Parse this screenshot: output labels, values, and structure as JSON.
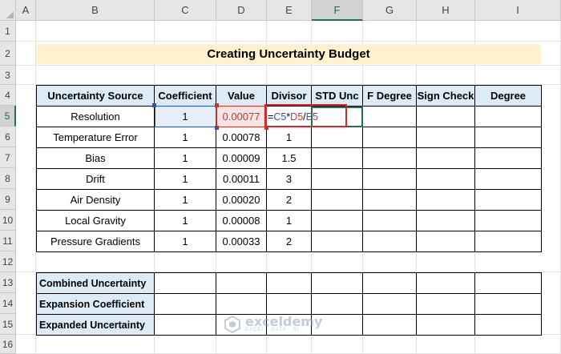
{
  "columns": [
    "A",
    "B",
    "C",
    "D",
    "E",
    "F",
    "G",
    "H",
    "I"
  ],
  "rows": [
    "1",
    "2",
    "3",
    "4",
    "5",
    "6",
    "7",
    "8",
    "9",
    "10",
    "11",
    "12",
    "13",
    "14",
    "15",
    "16"
  ],
  "title": "Creating Uncertainty Budget",
  "table": {
    "headers": [
      "Uncertainty Source",
      "Coefficient",
      "Value",
      "Divisor",
      "STD Unc",
      "F Degree",
      "Sign Check",
      "Degree"
    ],
    "rows": [
      {
        "source": "Resolution",
        "coefficient": "1",
        "value": "0.00077",
        "divisor": ""
      },
      {
        "source": "Temperature Error",
        "coefficient": "1",
        "value": "0.00078",
        "divisor": "1"
      },
      {
        "source": "Bias",
        "coefficient": "1",
        "value": "0.00009",
        "divisor": "1.5"
      },
      {
        "source": "Drift",
        "coefficient": "1",
        "value": "0.00011",
        "divisor": "3"
      },
      {
        "source": "Air Density",
        "coefficient": "1",
        "value": "0.00020",
        "divisor": "2"
      },
      {
        "source": "Local Gravity",
        "coefficient": "1",
        "value": "0.00008",
        "divisor": "1"
      },
      {
        "source": "Pressure Gradients",
        "coefficient": "1",
        "value": "0.00033",
        "divisor": "2"
      }
    ]
  },
  "formula": {
    "eq": "=",
    "ref1": "C5",
    "op1": "*",
    "ref2": "D5",
    "op2": "/",
    "ref3": "E5"
  },
  "summary": [
    "Combined Uncertainty",
    "Expansion Coefficient",
    "Expanded Uncertainty"
  ],
  "watermark": {
    "name": "exceldemy",
    "tagline": "EXCEL · DATA · BI"
  },
  "colors": {
    "header_fill": "#ddebf7",
    "title_fill": "#fff2cc",
    "selection": "#217346",
    "highlight_box": "#e0202a"
  }
}
